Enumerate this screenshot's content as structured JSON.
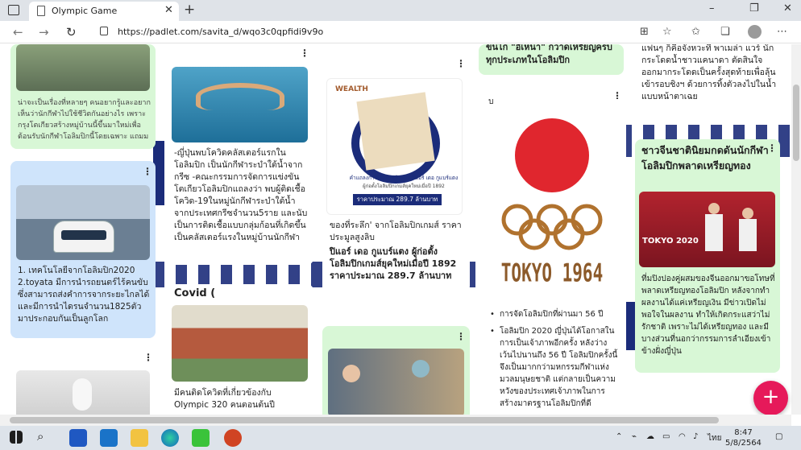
{
  "browser": {
    "tab_title": "Olympic Game",
    "tab_close": "✕",
    "new_tab": "+",
    "url": "https://padlet.com/savita_d/wqo3c0qpfidi9v9o",
    "min": "–",
    "max": "❐",
    "close": "✕"
  },
  "cards": {
    "c1_text": "น่าจะเป็นเรื่องที่หลายๆ คนอยากรู้และอยากเห็นว่านักกีฬาไปใช้ชีวิตกันอย่างไร เพราะกรุงโตเกียวสร้างหมู่บ้านนี้ขึ้นมาใหม่เพื่อต้อนรับนักกีฬาโอลิมปิกนี้โดยเฉพาะ แถมม",
    "c2_text": "1. เทคโนโลยีจากโอลิมปิก2020 2.toyata มีการนำรถยนตร์ไร้คนขับซึ่งสามารถส่งคำการจากระยะไกลได้ และมีการนำไดรนจำนวน1825ตัว มาประกอบกันเป็นลูกโลก",
    "c3_text": "-ญี่ปุ่นพบโควิดคลัสเตอร์แรกในโอลิมปิก เป็นนักกีฬาระบำใต้น้ำจากกรีซ -คณะกรรมการจัดการแข่งขันโตเกียวโอลิมปิกแถลงว่า พบผู้ติดเชื้อโควิด-19ในหมู่นักกีฬาระบำใต้น้ำจากประเทศกรีซจำนวน5ราย และนับเป็นการติดเชื้อแบบกลุ่มก้อนที่เกิดขึ้นเป็นคลัสเตอร์แรงในหมู่บ้านนักกีฬา",
    "c4_title": "Covid (",
    "c4_text": "มีคนติดโควิดที่เกี่ยวข้องกับ Olympic 320 คนตอนต้นปี",
    "c5_caption": "ของที่ระลึก' จากโอลิมปิกเกมส์ ราคาประมูลสูงลิบ",
    "c5_bold": "ปิแอร์ เดอ กูแบร์แตง ผู้ก่อตั้งโอลิมปิกเกมส์ยุคใหม่เมื่อปี 1892 ราคาประมาณ 289.7 ล้านบาท",
    "c5_wealth": "WEALTH",
    "c5_img_text1": "คำแถลงการณ์ฉบับจริงของ ปิแอร์ เดอ กูแบร์แตง",
    "c5_img_text2": "ผู้ก่อตั้งโอลิมปิกเกมส์ยุคใหม่เมื่อปี 1892",
    "c5_price_banner": "ราคาประมาณ 289.7 ล้านบาท",
    "c6_text": "ขนไก่ \"อีเหนา\" กวาดเหรียญครบทุกประเภทในโอลิมปิก",
    "c7_header": "ป",
    "c7_tokyo": "TOKYO 1964",
    "c7_bullet1": "การจัดโอลิมปิกที่ผ่านมา 56 ปี",
    "c7_bullet2": "โอลิมปิก 2020 ญี่ปุ่นได้โอกาสในการเป็นเจ้าภาพอีกครั้ง หลังว่างเว้นไปนานถึง 56 ปี โอลิมปิกครั้งนี้จึงเป็นมากกว่ามหกรรมกีฬาแห่งมวลมนุษยชาติ แต่กลายเป็นความหวังของประเทศเจ้าภาพในการสร้างมาตรฐานโอลิมปิกที่ดี",
    "c8_text": "แฟนๆ ก็คือจังหวะที่ พาเมล่า แวร์ นักกระโดดน้ำชาวแคนาดา ตัดสินใจออกมากระโดดเป็นครั้งสุดท้ายเพื่อลุ้นเข้ารอบชิงฯ ด้วยการทิ้งตัวลงไปในน้ำแบบหน้าตาเฉย",
    "c9_title": "ชาวจีนชาตินิยมกดดันนักกีฬาโอลิมปิกพลาดเหรียญทอง",
    "c9_img_text": "TOKYO 2020",
    "c9_text": "ที่มปิงปองคู่ผสมของจีนออกมาขอโทษที่พลาดเหรียญทองโอลิมปิก หลังจากทำผลงานได้แค่เหรียญเงิน มีข่าวเปิดไม่พอใจในผลงาน ทำให้เกิดกระแสว่าไม่รักชาติ เพราะไม่ได้เหรียญทอง และมีบางส่วนที่นอกว่ากรรมการลำเอียงเข้าข้างฝั่งญี่ปุ่น"
  },
  "fab": "+",
  "taskbar": {
    "lang": "ไทย",
    "time": "8:47",
    "date": "5/8/2564"
  },
  "colors": {
    "green_card": "#d8f7d6",
    "blue_card": "#cfe4fb",
    "fab": "#e6195a",
    "japan_red": "#e0262e",
    "olympic_ring": "#b0722e"
  }
}
